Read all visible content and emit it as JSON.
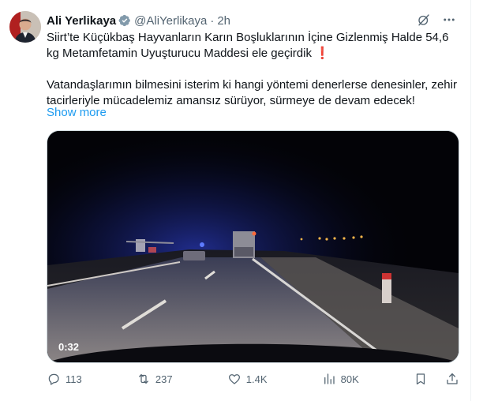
{
  "post": {
    "author_name": "Ali Yerlikaya",
    "handle": "@AliYerlikaya",
    "separator": "·",
    "time": "2h",
    "text_line_1": "Siirt’te Küçükbaş Hayvanların Karın Boşluklarının İçine Gizlenmiş Halde 54,6 kg Metamfetamin Uyuşturucu Maddesi ele geçirdik",
    "exclamation": "❗",
    "text_line_2": "Vatandaşlarımın bilmesini isterim ki hangi yöntemi denerlerse denesinler, zehir tacirleriyle mücadelemiz amansız sürüyor, sürmeye de devam edecek!",
    "show_more": "Show more",
    "video_duration": "0:32"
  },
  "actions": {
    "replies": "113",
    "reposts": "237",
    "likes": "1.4K",
    "views": "80K"
  },
  "icons": {
    "verified": "verified-badge-icon",
    "grok": "grok-icon",
    "more": "more-icon",
    "reply": "reply-icon",
    "repost": "repost-icon",
    "like": "like-icon",
    "views": "views-icon",
    "bookmark": "bookmark-icon",
    "share": "share-icon"
  },
  "colors": {
    "accent": "#1d9bf0",
    "text": "#0f1419",
    "secondary": "#536471",
    "verified_gray": "#829aab"
  }
}
